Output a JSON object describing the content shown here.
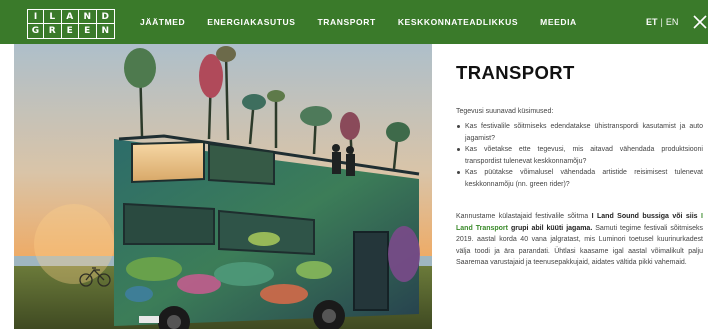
{
  "header": {
    "logo": {
      "top_letters": [
        "L",
        "A",
        "N",
        "D"
      ],
      "bottom_letters": [
        "G",
        "R",
        "E",
        "E",
        "N"
      ],
      "mark": "I",
      "bg_color": "#3a7a2a"
    },
    "nav": [
      {
        "label": "JÄÄTMED",
        "active": false
      },
      {
        "label": "ENERGIAKASUTUS",
        "active": false
      },
      {
        "label": "TRANSPORT",
        "active": true
      },
      {
        "label": "KESKKONNATEADLIKKUS",
        "active": false
      },
      {
        "label": "MEEDIA",
        "active": false
      }
    ],
    "lang": {
      "current": "ET",
      "separator": "|",
      "other": "EN"
    },
    "close_icon": "close-icon"
  },
  "hero": {
    "subject": "painted-double-decker-bus",
    "sky_colors": [
      "#b9c7cf",
      "#e6b88a",
      "#f0a860"
    ]
  },
  "article": {
    "title": "TRANSPORT",
    "lead": "Tegevusi suunavad küsimused:",
    "questions": [
      "Kas festivalile sõitmiseks edendatakse ühistranspordi kasutamist ja auto jagamist?",
      "Kas võetakse ette tegevusi, mis aitavad vähendada produktsiooni transpordist tulenevat keskkonnamõju?",
      "Kas püütakse võimalusel vähendada artistide reisimisest tulenevat keskkonnamõju (nn. green rider)?"
    ],
    "paragraph": {
      "part1": "Kannustame külastajaid festivalile sõitma ",
      "bold1": "I Land Sound bussiga või siis",
      "part2": " ",
      "green1": "I Land Transport",
      "bold2": " grupi abil küüti jagama.",
      "part3": " Samuti tegime festivali sõitmiseks 2019. aastal korda 40 vana jalgratast, mis Luminori toetusel kuurinurkadest välja toodi ja ära parandati. Ühtlasi kaasame igal aastal võimalikult palju Saaremaa varustajaid ja teenusepakkujaid, aidates vältida pikki vahemaid."
    },
    "accent_color": "#3a8a2a"
  }
}
